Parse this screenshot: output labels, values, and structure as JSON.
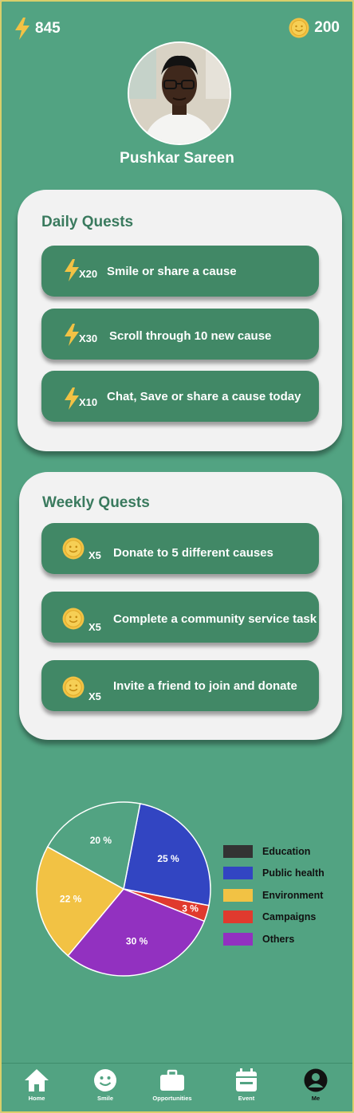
{
  "header": {
    "energy_icon": "lightning-bolt-icon",
    "energy": "845",
    "coins_icon": "smiley-coin-icon",
    "coins": "200"
  },
  "profile": {
    "name": "Pushkar Sareen"
  },
  "daily": {
    "title": "Daily Quests",
    "quests": [
      {
        "icon": "lightning-bolt-icon",
        "mult": "X20",
        "text": "Smile or share a cause"
      },
      {
        "icon": "lightning-bolt-icon",
        "mult": "X30",
        "text": "Scroll through 10 new cause"
      },
      {
        "icon": "lightning-bolt-icon",
        "mult": "X10",
        "text": "Chat, Save or share a cause today"
      }
    ]
  },
  "weekly": {
    "title": "Weekly  Quests",
    "quests": [
      {
        "icon": "smiley-coin-icon",
        "mult": "X5",
        "text": "Donate to 5 different causes"
      },
      {
        "icon": "smiley-coin-icon",
        "mult": "X5",
        "text": "Complete a community service task"
      },
      {
        "icon": "smiley-coin-icon",
        "mult": "X5",
        "text": "Invite a friend to join and donate"
      }
    ]
  },
  "chart_data": {
    "type": "pie",
    "legend_position": "right",
    "slices": [
      {
        "name": "Public health",
        "value": 25,
        "label": "25 %",
        "color": "#3245c2"
      },
      {
        "name": "Campaigns",
        "value": 3,
        "label": "3 %",
        "color": "#e03a2e"
      },
      {
        "name": "Others",
        "value": 30,
        "label": "30 %",
        "color": "#9231c0"
      },
      {
        "name": "Environment",
        "value": 22,
        "label": "22 %",
        "color": "#f2c244"
      },
      {
        "name": "Education",
        "value": 20,
        "label": "20 %",
        "color": "#52a382"
      }
    ],
    "legend": [
      {
        "label": "Education",
        "color": "#333333"
      },
      {
        "label": "Public health",
        "color": "#3245c2"
      },
      {
        "label": "Environment",
        "color": "#f2c244"
      },
      {
        "label": "Campaigns",
        "color": "#e03a2e"
      },
      {
        "label": "Others",
        "color": "#9231c0"
      }
    ]
  },
  "nav": {
    "items": [
      {
        "label": "Home",
        "icon": "home-icon"
      },
      {
        "label": "Smile",
        "icon": "smile-icon"
      },
      {
        "label": "Opportunities",
        "icon": "briefcase-icon"
      },
      {
        "label": "Event",
        "icon": "calendar-icon"
      },
      {
        "label": "Me",
        "icon": "user-icon",
        "active": true
      }
    ]
  },
  "colors": {
    "background": "#52a382",
    "quest": "#418866",
    "card": "#f2f2f2",
    "title": "#3a7a5e"
  }
}
